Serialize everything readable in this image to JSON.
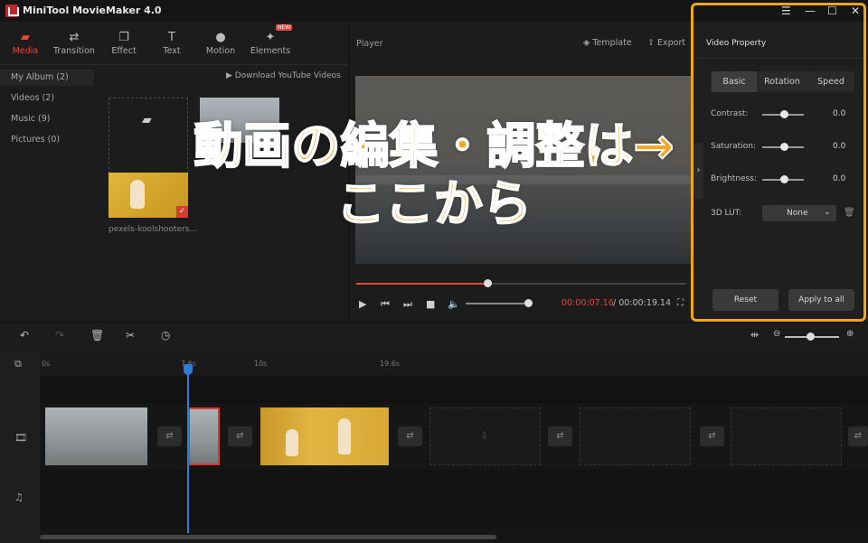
{
  "app": {
    "title": "MiniTool MovieMaker 4.0"
  },
  "toolbar": {
    "items": [
      {
        "label": "Media",
        "icon": "folder-icon"
      },
      {
        "label": "Transition",
        "icon": "transition-icon"
      },
      {
        "label": "Effect",
        "icon": "effect-icon"
      },
      {
        "label": "Text",
        "icon": "text-icon"
      },
      {
        "label": "Motion",
        "icon": "motion-icon"
      },
      {
        "label": "Elements",
        "icon": "elements-icon"
      }
    ],
    "new_badge": "NEW"
  },
  "library": {
    "items": [
      "My Album (2)",
      "Videos (2)",
      "Music (9)",
      "Pictures (0)"
    ],
    "download_label": "Download YouTube Videos",
    "thumb_caption": "pexels-koolshooters..."
  },
  "player": {
    "label": "Player",
    "template_label": "Template",
    "export_label": "Export",
    "time_current": "00:00:07.16",
    "time_total": " / 00:00:19.14",
    "progress": 0.39,
    "volume": 0.9
  },
  "property": {
    "title": "Video Property",
    "tabs": [
      "Basic",
      "Rotation",
      "Speed"
    ],
    "selected_tab": "Basic",
    "contrast_label": "Contrast:",
    "contrast_value": "0.0",
    "saturation_label": "Saturation:",
    "saturation_value": "0.0",
    "brightness_label": "Brightness:",
    "brightness_value": "0.0",
    "lut_label": "3D LUT:",
    "lut_value": "None",
    "reset_label": "Reset",
    "apply_label": "Apply to all"
  },
  "timeline": {
    "ticks": [
      "0s",
      "7.6s",
      "10s",
      "19.6s"
    ]
  },
  "overlay": {
    "text": "動画の編集・調整は→\nここから"
  },
  "colors": {
    "accent": "#e8463a",
    "highlight": "#f0a51c",
    "playhead": "#2f7fd8"
  }
}
